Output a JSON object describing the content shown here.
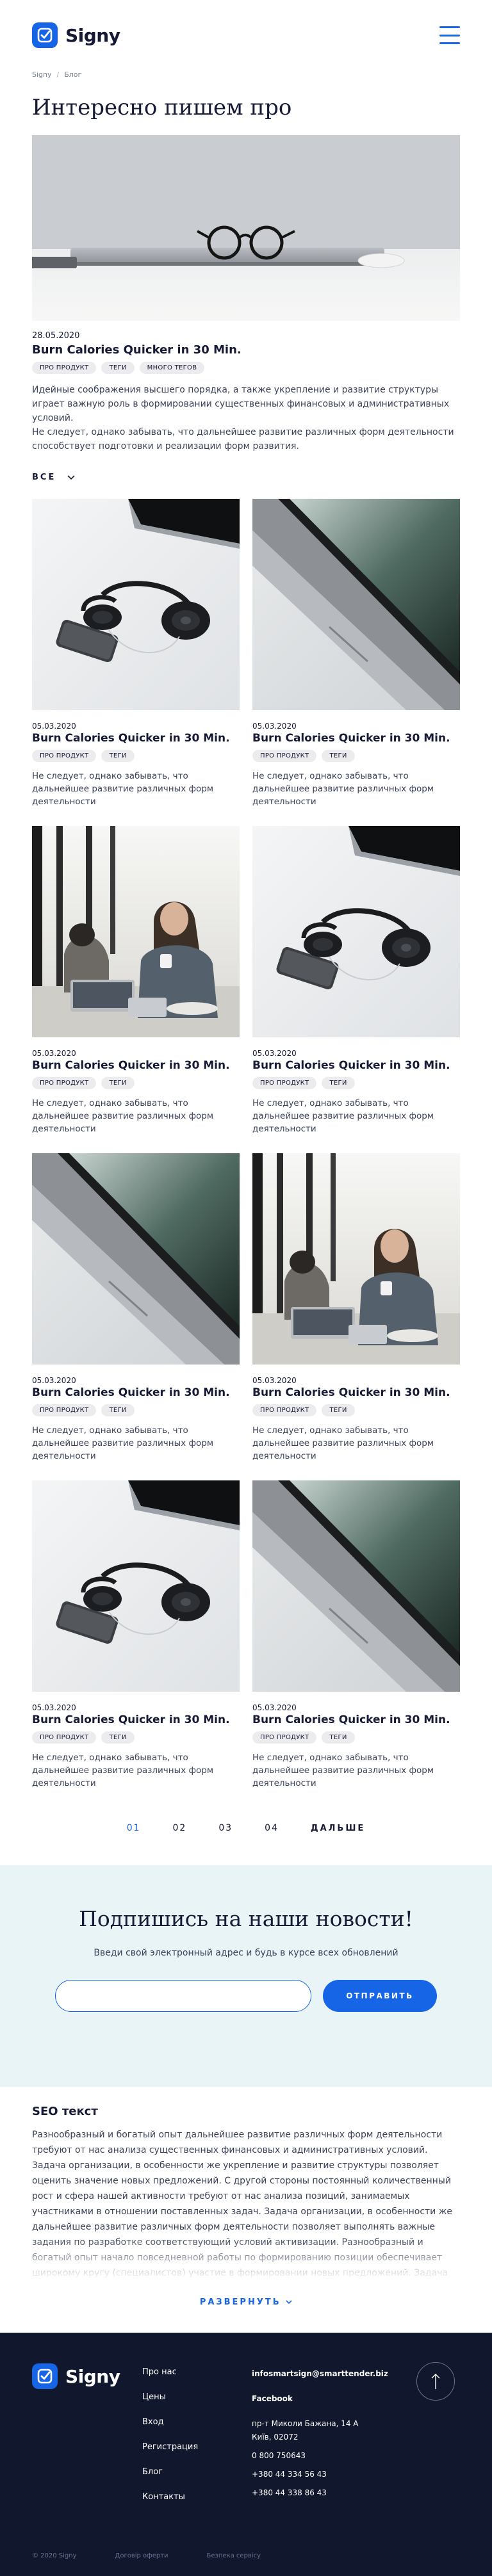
{
  "header": {
    "logo_text": "Signy"
  },
  "breadcrumb": {
    "home": "Signy",
    "separator": "/",
    "current": "Блог"
  },
  "page_title": "Интересно пишем про",
  "featured": {
    "date": "28.05.2020",
    "title": "Burn Calories Quicker in 30 Min.",
    "tags": [
      "ПРО ПРОДУКТ",
      "ТЕГИ",
      "МНОГО ТЕГОВ"
    ],
    "text1": "Идейные соображения высшего порядка, а также укрепление и развитие структуры играет важную роль в формировании существенных финансовых и административных условий.",
    "text2": "Не следует, однако забывать, что дальнейшее развитие различных форм деятельности способствует подготовки и реализации форм развития."
  },
  "filter": {
    "label": "ВСЕ"
  },
  "cards": [
    {
      "image": "headphones",
      "date": "05.03.2020",
      "title": "Burn Calories Quicker in 30 Min.",
      "tags": [
        "ПРО ПРОДУКТ",
        "ТЕГИ"
      ],
      "text": "Не следует, однако забывать, что дальнейшее развитие различных форм деятельности"
    },
    {
      "image": "laptop",
      "date": "05.03.2020",
      "title": "Burn Calories Quicker in 30 Min.",
      "tags": [
        "ПРО ПРОДУКТ",
        "ТЕГИ"
      ],
      "text": "Не следует, однако забывать, что дальнейшее развитие различных форм деятельности"
    },
    {
      "image": "woman",
      "date": "05.03.2020",
      "title": "Burn Calories Quicker in 30 Min.",
      "tags": [
        "ПРО ПРОДУКТ",
        "ТЕГИ"
      ],
      "text": "Не следует, однако забывать, что дальнейшее развитие различных форм деятельности"
    },
    {
      "image": "headphones",
      "date": "05.03.2020",
      "title": "Burn Calories Quicker in 30 Min.",
      "tags": [
        "ПРО ПРОДУКТ",
        "ТЕГИ"
      ],
      "text": "Не следует, однако забывать, что дальнейшее развитие различных форм деятельности"
    },
    {
      "image": "laptop",
      "date": "05.03.2020",
      "title": "Burn Calories Quicker in 30 Min.",
      "tags": [
        "ПРО ПРОДУКТ",
        "ТЕГИ"
      ],
      "text": "Не следует, однако забывать, что дальнейшее развитие различных форм деятельности"
    },
    {
      "image": "woman",
      "date": "05.03.2020",
      "title": "Burn Calories Quicker in 30 Min.",
      "tags": [
        "ПРО ПРОДУКТ",
        "ТЕГИ"
      ],
      "text": "Не следует, однако забывать, что дальнейшее развитие различных форм деятельности"
    },
    {
      "image": "headphones",
      "date": "05.03.2020",
      "title": "Burn Calories Quicker in 30 Min.",
      "tags": [
        "ПРО ПРОДУКТ",
        "ТЕГИ"
      ],
      "text": "Не следует, однако забывать, что дальнейшее развитие различных форм деятельности"
    },
    {
      "image": "laptop",
      "date": "05.03.2020",
      "title": "Burn Calories Quicker in 30 Min.",
      "tags": [
        "ПРО ПРОДУКТ",
        "ТЕГИ"
      ],
      "text": "Не следует, однако забывать, что дальнейшее развитие различных форм деятельности"
    }
  ],
  "pagination": {
    "pages": [
      "01",
      "02",
      "03",
      "04"
    ],
    "active": "01",
    "next": "ДАЛЬШЕ"
  },
  "subscribe": {
    "title": "Подпишись на наши новости!",
    "description": "Введи свой электронный адрес и будь в курсе всех обновлений",
    "input_placeholder": "",
    "button": "ОТПРАВИТЬ"
  },
  "seo": {
    "title": "SEO текст",
    "text": "Разнообразный и богатый опыт дальнейшее развитие различных форм деятельности требуют от нас анализа существенных финансовых и административных условий. Задача организации, в особенности же укрепление и развитие структуры позволяет оценить значение новых предложений. С другой стороны постоянный количественный рост и сфера нашей активности требуют от нас анализа позиций, занимаемых участниками в отношении поставленных задач. Задача организации, в особенности же дальнейшее развитие различных форм деятельности позволяет выполнять важные задания по разработке соответствующий условий активизации. Разнообразный и богатый опыт начало повседневной работы по формированию позиции обеспечивает широкому кругу (специалистов) участие в формировании новых предложений. Задача организации",
    "expand": "РАЗВЕРНУТЬ"
  },
  "footer": {
    "logo_text": "Signy",
    "nav": [
      "Про нас",
      "Цены",
      "Вход",
      "Регистрация",
      "Блог",
      "Контакты"
    ],
    "email": "infosmartsign@smarttender.biz",
    "facebook": "Facebook",
    "address1": "пр-т Миколи Бажана, 14 А",
    "address2": "Київ, 02072",
    "phones": [
      "0 800 750643",
      "+380 44 334 56 43",
      "+380 44 338 86 43"
    ],
    "copyright": "© 2020 Signy",
    "link1": "Договір оферти",
    "link2": "Безпека сервісу"
  },
  "colors": {
    "accent": "#1565e6",
    "dark": "#11172d",
    "subscribe_bg": "#e8f4f6"
  }
}
